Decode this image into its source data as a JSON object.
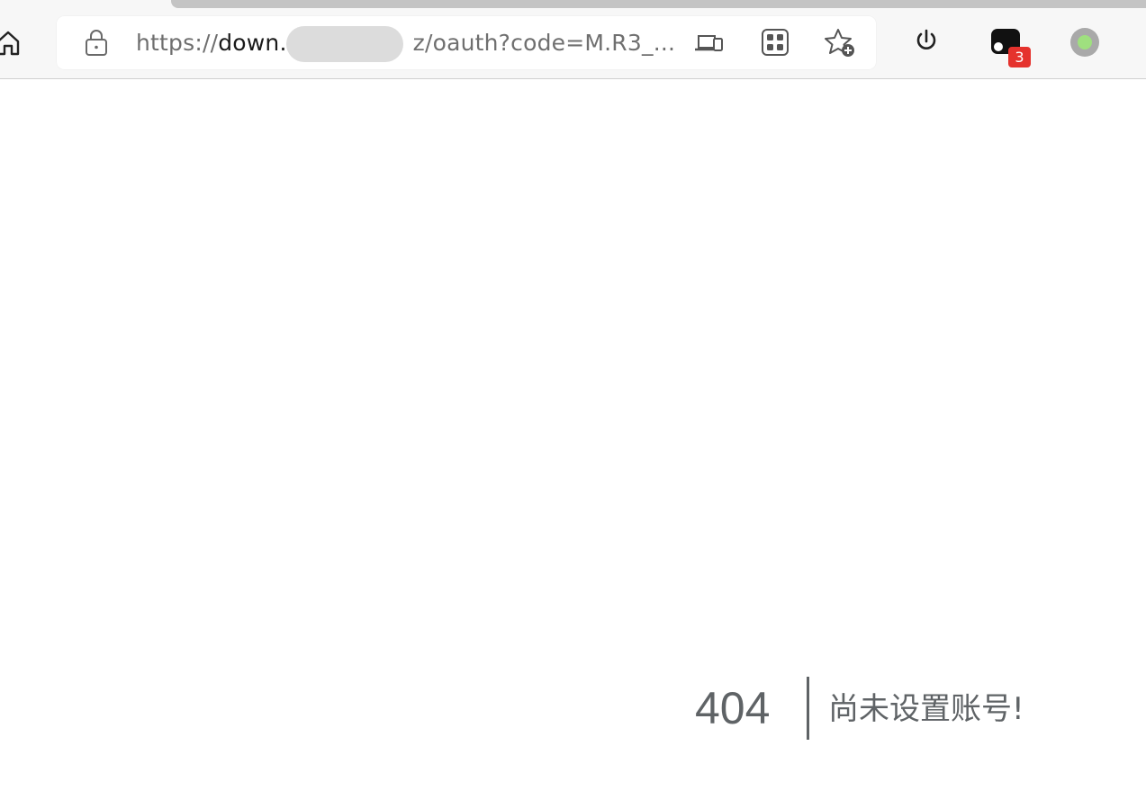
{
  "browser": {
    "url": {
      "scheme": "https://",
      "host_visible": "down.",
      "path_visible": "z/oauth?code=M.R3_",
      "ellipsis": "..."
    },
    "toolbar": {
      "icons": [
        "home-icon",
        "lock-icon",
        "device-icon",
        "apps-grid-icon",
        "favorite-add-icon",
        "power-icon",
        "extension-icon",
        "profile-icon"
      ],
      "extension_badge": "3"
    },
    "colors": {
      "badge": "#e5322d",
      "profile_dot": "#8fd17a"
    }
  },
  "page": {
    "error_code": "404",
    "error_message": "尚未设置账号!"
  }
}
